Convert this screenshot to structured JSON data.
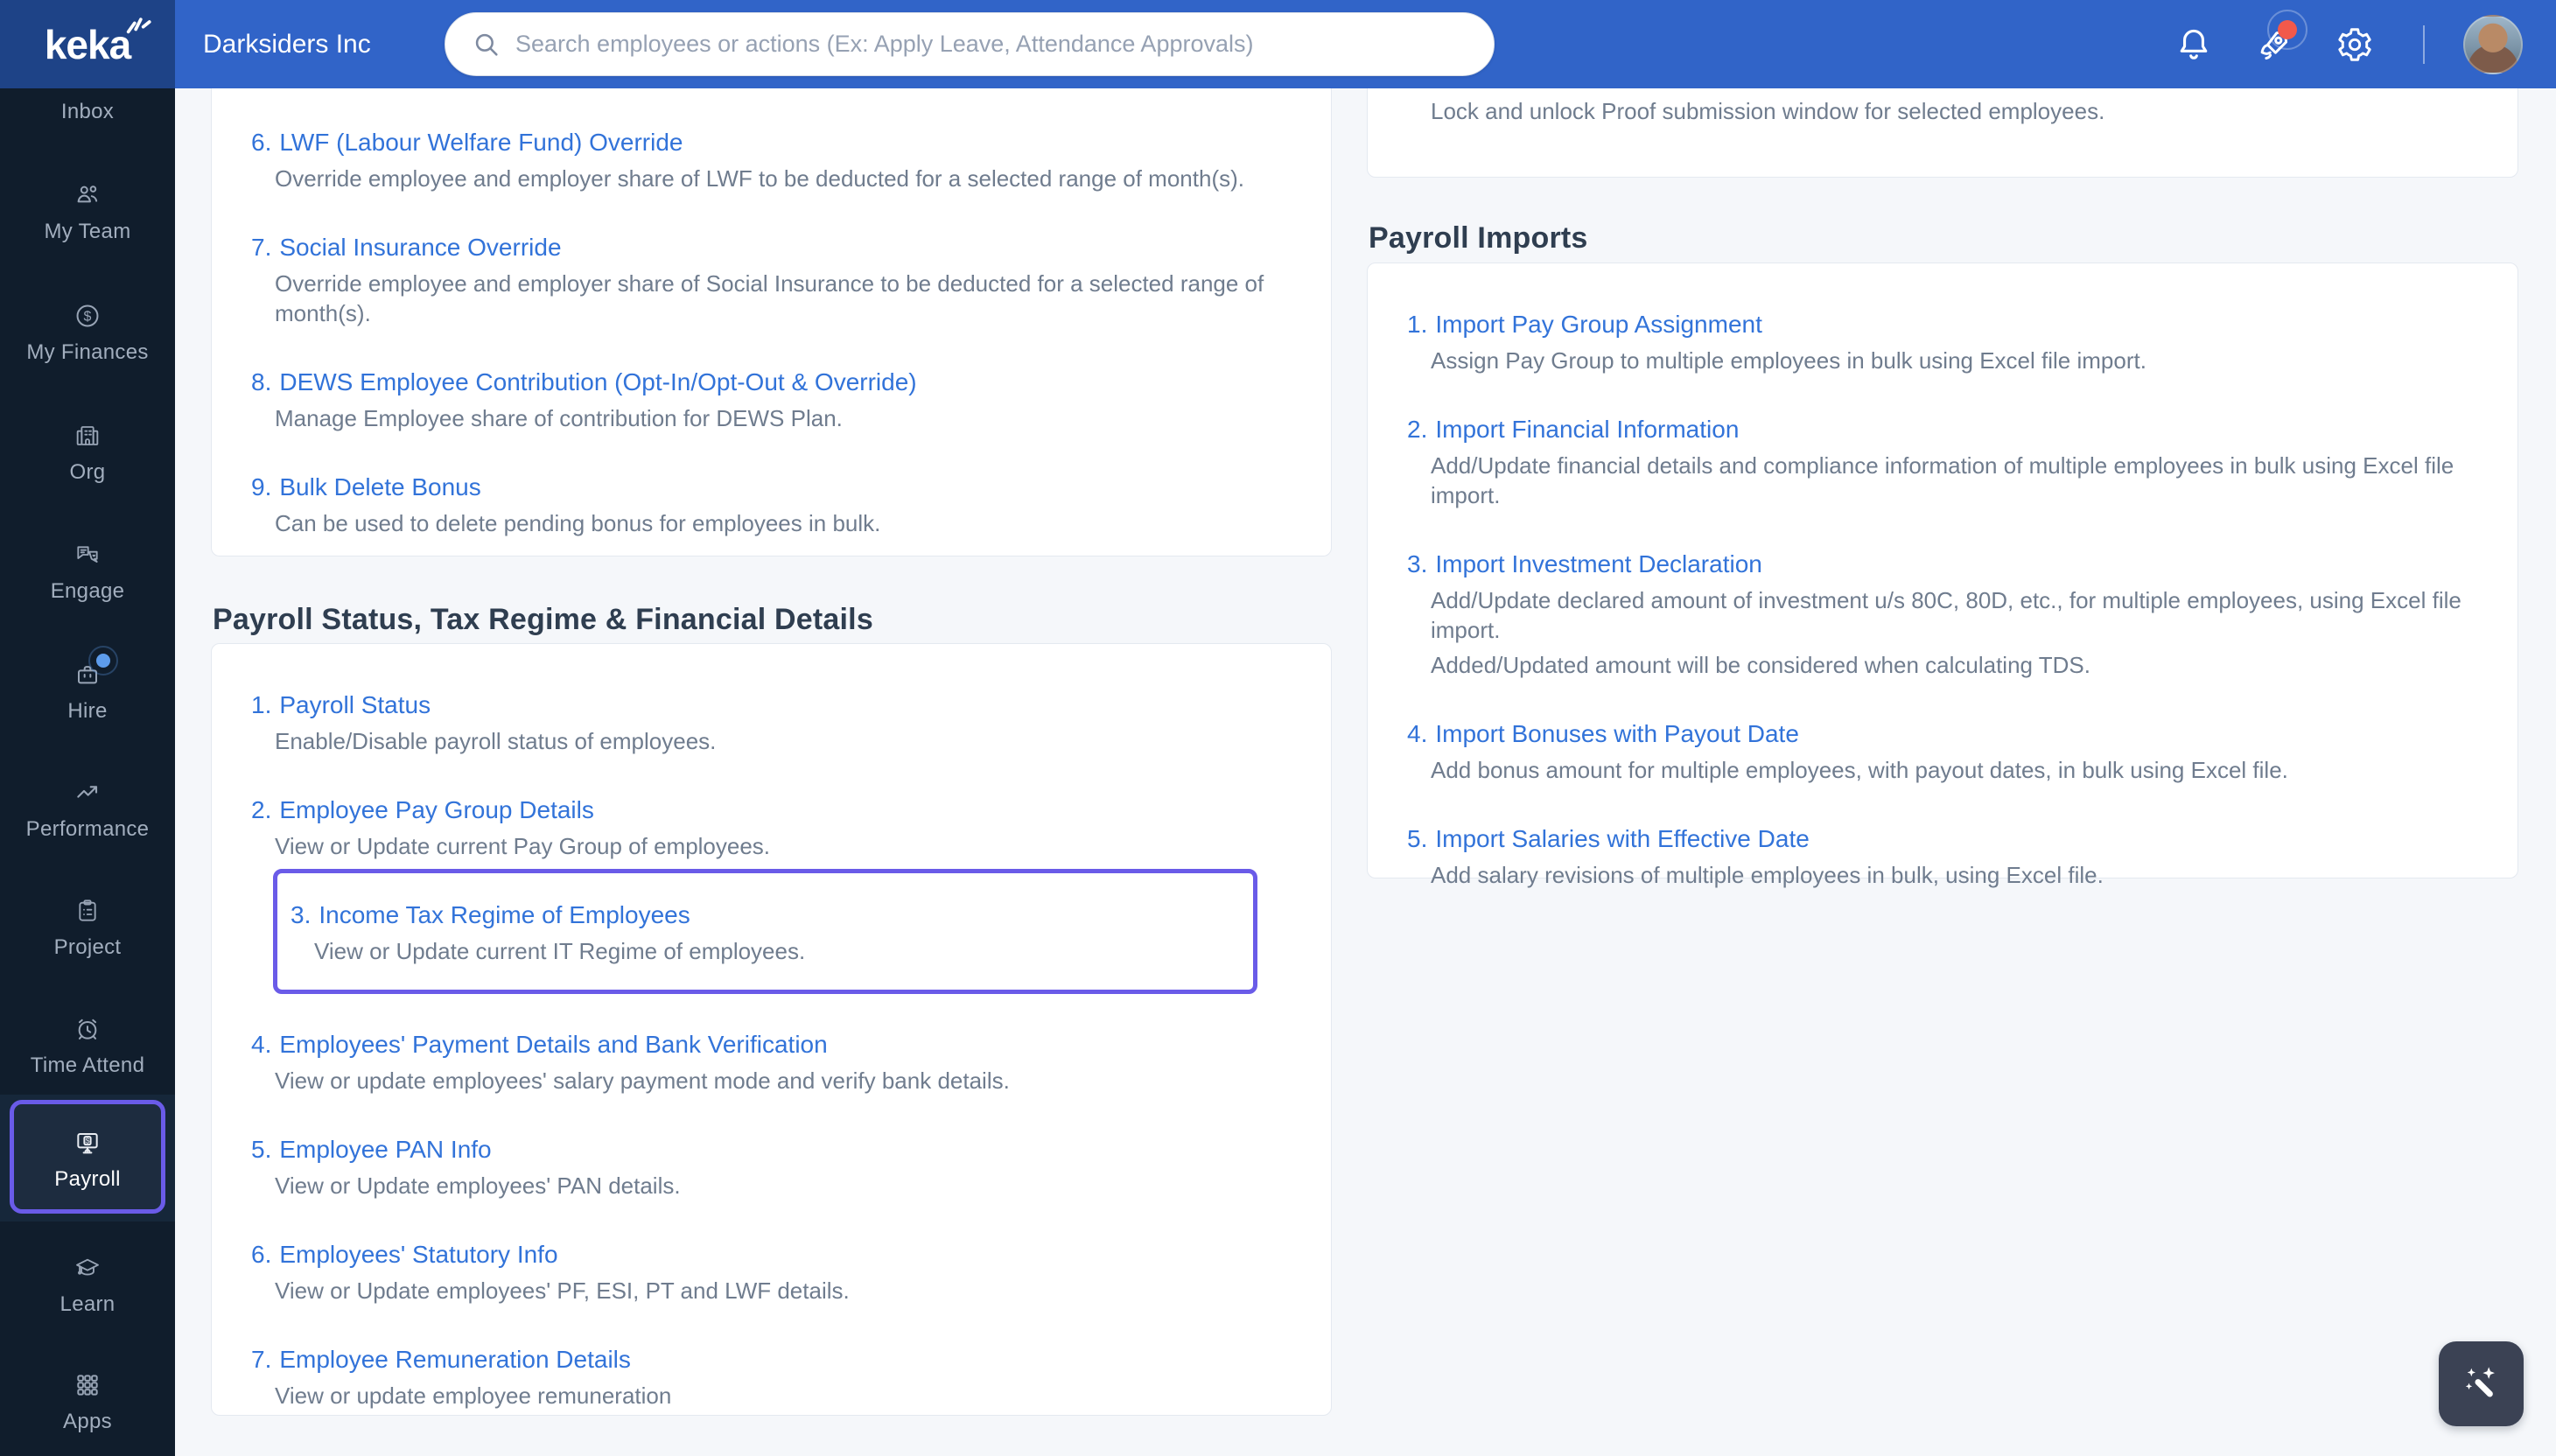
{
  "app": {
    "logo_text": "keka",
    "company_name": "Darksiders Inc"
  },
  "topbar": {
    "search_placeholder": "Search employees or actions (Ex: Apply Leave, Attendance Approvals)"
  },
  "sidebar": {
    "items": [
      {
        "label": "Inbox",
        "icon": "inbox-icon"
      },
      {
        "label": "My Team",
        "icon": "team-icon"
      },
      {
        "label": "My Finances",
        "icon": "finances-icon"
      },
      {
        "label": "Org",
        "icon": "org-icon"
      },
      {
        "label": "Engage",
        "icon": "engage-icon"
      },
      {
        "label": "Hire",
        "icon": "hire-icon",
        "has_badge": true
      },
      {
        "label": "Performance",
        "icon": "performance-icon"
      },
      {
        "label": "Project",
        "icon": "project-icon"
      },
      {
        "label": "Time Attend",
        "icon": "time-attend-icon"
      },
      {
        "label": "Payroll",
        "icon": "payroll-icon",
        "active": true
      },
      {
        "label": "Learn",
        "icon": "learn-icon"
      },
      {
        "label": "Apps",
        "icon": "apps-icon"
      }
    ]
  },
  "main": {
    "left": {
      "top_card_items": [
        {
          "num": "6.",
          "title": "LWF (Labour Welfare Fund) Override",
          "desc": "Override employee and employer share of LWF to be deducted for a selected range of month(s)."
        },
        {
          "num": "7.",
          "title": "Social Insurance Override",
          "desc": "Override employee and employer share of Social Insurance to be deducted for a selected range of month(s)."
        },
        {
          "num": "8.",
          "title": "DEWS Employee Contribution (Opt-In/Opt-Out & Override)",
          "desc": "Manage Employee share of contribution for DEWS Plan."
        },
        {
          "num": "9.",
          "title": "Bulk Delete Bonus",
          "desc": "Can be used to delete pending bonus for employees in bulk."
        }
      ],
      "section_title": "Payroll Status, Tax Regime & Financial Details",
      "section_items": [
        {
          "num": "1.",
          "title": "Payroll Status",
          "desc": "Enable/Disable payroll status of employees."
        },
        {
          "num": "2.",
          "title": "Employee Pay Group Details",
          "desc": "View or Update current Pay Group of employees."
        },
        {
          "num": "3.",
          "title": "Income Tax Regime of Employees",
          "desc": "View or Update current IT Regime of employees.",
          "highlighted": true
        },
        {
          "num": "4.",
          "title": "Employees' Payment Details and Bank Verification",
          "desc": "View or update employees' salary payment mode and verify bank details."
        },
        {
          "num": "5.",
          "title": "Employee PAN Info",
          "desc": "View or Update employees' PAN details."
        },
        {
          "num": "6.",
          "title": "Employees' Statutory Info",
          "desc": "View or Update employees' PF, ESI, PT and LWF details."
        },
        {
          "num": "7.",
          "title": "Employee Remuneration Details",
          "desc": "View or update employee remuneration"
        }
      ]
    },
    "right": {
      "partial_card_desc": "Lock and unlock Proof submission window for selected employees.",
      "section_title": "Payroll Imports",
      "section_items": [
        {
          "num": "1.",
          "title": "Import Pay Group Assignment",
          "desc": "Assign Pay Group to multiple employees in bulk using Excel file import."
        },
        {
          "num": "2.",
          "title": "Import Financial Information",
          "desc": "Add/Update financial details and compliance information of multiple employees in bulk using Excel file import."
        },
        {
          "num": "3.",
          "title": "Import Investment Declaration",
          "desc": "Add/Update declared amount of investment u/s 80C, 80D, etc., for multiple employees, using Excel file import.",
          "desc2": "Added/Updated amount will be considered when calculating TDS."
        },
        {
          "num": "4.",
          "title": "Import Bonuses with Payout Date",
          "desc": "Add bonus amount for multiple employees, with payout dates, in bulk using Excel file."
        },
        {
          "num": "5.",
          "title": "Import Salaries with Effective Date",
          "desc": "Add salary revisions of multiple employees in bulk, using Excel file."
        }
      ]
    }
  },
  "colors": {
    "topbar_blue": "#3164C8",
    "logo_navy": "#1E4387",
    "sidebar_navy": "#101D2C",
    "accent_purple": "#6A5BE8",
    "link_blue": "#3273D9",
    "desc_gray": "#6F7C8E",
    "badge_red": "#F2594B",
    "hire_badge_blue": "#5D9CEC",
    "page_bg": "#F5F7FA"
  }
}
